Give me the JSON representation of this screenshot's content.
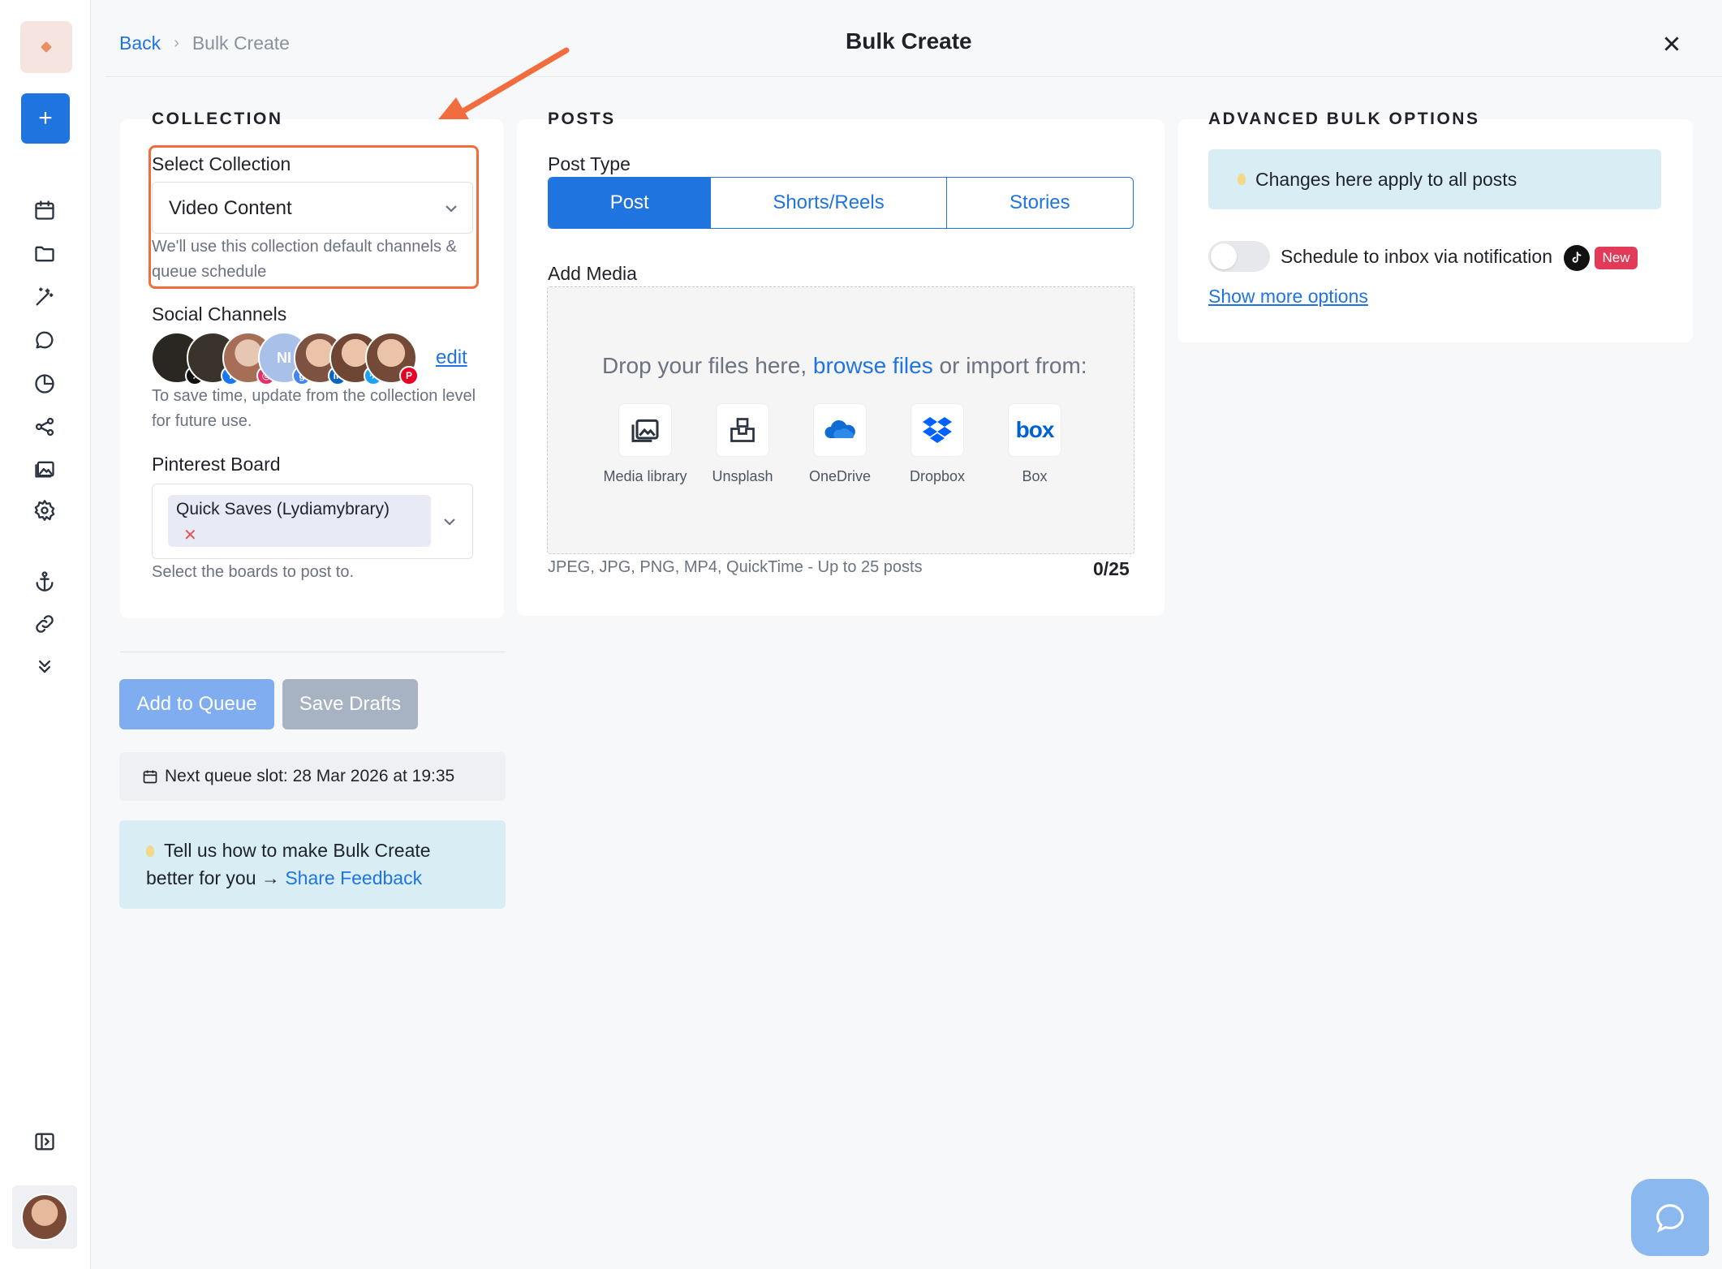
{
  "header": {
    "back_label": "Back",
    "breadcrumb_separator": "›",
    "breadcrumb_current": "Bulk Create",
    "title": "Bulk Create"
  },
  "sidebar": {
    "plus_label": "+",
    "items": [
      {
        "icon": "calendar-icon"
      },
      {
        "icon": "folder-icon"
      },
      {
        "icon": "magic-wand-icon"
      },
      {
        "icon": "chat-icon"
      },
      {
        "icon": "pie-chart-icon"
      },
      {
        "icon": "share-icon"
      },
      {
        "icon": "gallery-icon"
      },
      {
        "icon": "gear-icon"
      },
      {
        "icon": "anchor-icon"
      },
      {
        "icon": "link-icon"
      },
      {
        "icon": "chevrons-down-icon"
      }
    ],
    "collapse_icon": "sidebar-toggle-icon"
  },
  "collection": {
    "section_title": "COLLECTION",
    "select_label": "Select Collection",
    "selected_value": "Video Content",
    "select_help": "We'll use this collection default channels & queue schedule",
    "channels_label": "Social Channels",
    "edit_label": "edit",
    "channels_help": "To save time, update from the collection level for future use.",
    "channel_avatars": [
      {
        "initials": "",
        "badge": "tiktok"
      },
      {
        "initials": "",
        "badge": "facebook"
      },
      {
        "initials": "",
        "badge": "instagram"
      },
      {
        "initials": "NI",
        "badge": "google"
      },
      {
        "initials": "",
        "badge": "linkedin"
      },
      {
        "initials": "",
        "badge": "bluesky"
      },
      {
        "initials": "",
        "badge": "pinterest"
      }
    ],
    "pinterest_label": "Pinterest Board",
    "pinterest_tag": "Quick Saves (Lydiamybrary)",
    "pinterest_tag_remove": "✕",
    "pinterest_help": "Select the boards to post to."
  },
  "actions": {
    "add_to_queue": "Add to Queue",
    "save_drafts": "Save Drafts",
    "next_slot": "Next queue slot: 28 Mar 2026 at 19:35"
  },
  "feedback": {
    "text": "Tell us how to make Bulk Create better for you",
    "arrow": "→",
    "link": "Share Feedback"
  },
  "posts": {
    "section_title": "POSTS",
    "post_type_label": "Post Type",
    "post_types": [
      "Post",
      "Shorts/Reels",
      "Stories"
    ],
    "active_post_type": "Post",
    "add_media_label": "Add Media",
    "drop_text_before": "Drop your files here, ",
    "drop_link": "browse files",
    "drop_text_after": " or import from:",
    "sources": [
      {
        "name": "Media library",
        "icon": "media-library-icon"
      },
      {
        "name": "Unsplash",
        "icon": "unsplash-icon"
      },
      {
        "name": "OneDrive",
        "icon": "onedrive-icon"
      },
      {
        "name": "Dropbox",
        "icon": "dropbox-icon"
      },
      {
        "name": "Box",
        "icon": "box-icon"
      }
    ],
    "box_logo_text": "box",
    "formats": "JPEG, JPG, PNG, MP4, QuickTime - Up to 25 posts",
    "count": "0/25"
  },
  "advanced": {
    "section_title": "ADVANCED BULK OPTIONS",
    "info": "Changes here apply to all posts",
    "schedule_label": "Schedule to inbox via notification",
    "schedule_enabled": false,
    "new_badge": "New",
    "more_options": "Show more options"
  },
  "colors": {
    "accent": "#1f74e0",
    "highlight_border": "#f26d3d",
    "info_bg": "#d8eef4",
    "new_badge": "#e23b5a"
  }
}
